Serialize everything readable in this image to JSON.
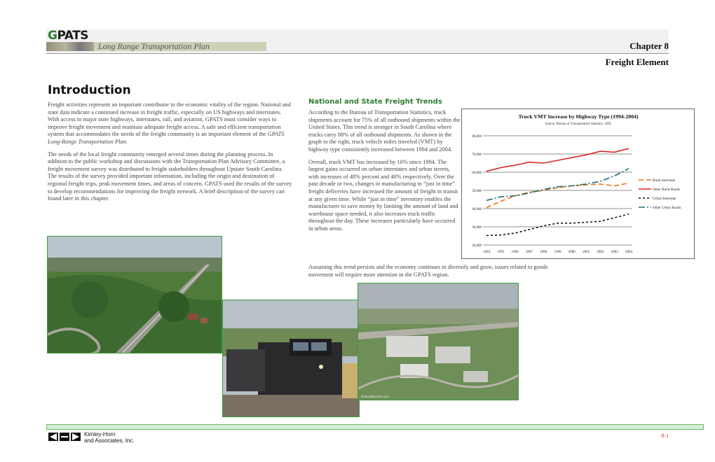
{
  "header": {
    "logo_g": "G",
    "logo_rest": "PATS",
    "plan_title": "Long Range Transportation Plan",
    "chapter": "Chapter 8",
    "element_title": "Freight Element"
  },
  "intro": {
    "heading": "Introduction",
    "p1a": "Freight activities represent an important contributor to the economic vitality of the region. National and state data indicate a continued increase in freight traffic, especially on US highways and interstates. With access to major state highways, interstates, rail, and aviation, GPATS must consider ways to improve freight movement and maintain adequate freight access. A safe and efficient transportation system that accommodates the needs of the freight community is an important element of the ",
    "p1_em": "GPATS Long-Range Transportation Plan.",
    "p2": "The needs of the local freight community emerged several times during the planning process. In addition to the public workshop and discussions with the Transportation Plan Advisory Committee, a freight movement survey was distributed to freight stakeholders throughout Upstate South Carolina. The results of the survey provided important information, including the origin and destination of regional freight trips, peak movement times, and areas of concern. GPATS used the results of the survey to develop recommendations for improving the freight network. A brief description of the survey can found later in this chapter."
  },
  "trends": {
    "heading": "National and State Freight Trends",
    "p1": "According to the Bureau of Transportation Statistics, truck shipments account for 75% of all outbound shipments within the United States. This trend is stronger in South Carolina where trucks carry 88% of all outbound shipments. As shown in the graph to the right, truck vehicle miles traveled (VMT) by highway type consistently increased between 1994 and 2004.",
    "p2": "Overall, truck VMT has increased by 10% since 1994. The largest gains occurred on urban interstates and urban streets, with increases of 48% percent and 40% respectively. Over the past decade or two, changes in manufacturing to “just in time” freight deliveries have increased the amount of freight in transit at any given time. While “just in time” inventory enables the manufacturer to save money by limiting the amount of land and warehouse space needed, it also increases truck traffic throughout the day. These increases particularly have occurred in urban areas.",
    "p3": "Assuming this trend persists and the economy continues to diversify and grow, issues related to goods movement will require more attention in the GPATS region."
  },
  "photos": {
    "photo3_credit": "RailroadCorner.com"
  },
  "chart_data": {
    "type": "line",
    "title": "Truck VMT Increase by Highway Type (1994-2004)",
    "subtitle": "Source: Bureau of Transportation Statistics, 2005",
    "x": [
      "1994",
      "1995",
      "1996",
      "1997",
      "1998",
      "1999",
      "2000",
      "2001",
      "2002",
      "2003",
      "2004"
    ],
    "y_ticks": [
      "80,000",
      "70,000",
      "60,000",
      "50,000",
      "40,000",
      "30,000",
      "20,000"
    ],
    "ylim": [
      20000,
      80000
    ],
    "legend_position": "right",
    "series": [
      {
        "name": "Rural Interstate",
        "color": "#e8731c",
        "dash": "7,4",
        "values": [
          40500,
          44000,
          47000,
          49000,
          50000,
          51500,
          52500,
          53000,
          53500,
          52500,
          54000
        ]
      },
      {
        "name": "Other Rural Roads",
        "color": "#d62728",
        "dash": "",
        "values": [
          60500,
          62500,
          63800,
          65500,
          65000,
          66500,
          68000,
          69500,
          71500,
          71000,
          73000
        ]
      },
      {
        "name": "Urban Interstate",
        "color": "#111111",
        "dash": "3,3",
        "values": [
          25200,
          25500,
          26500,
          28500,
          30500,
          32000,
          32000,
          32500,
          33000,
          35000,
          37000
        ]
      },
      {
        "name": "Other Urban Roads",
        "color": "#1f6f7a",
        "dash": "9,3,2,3",
        "values": [
          44500,
          46500,
          47000,
          48500,
          50500,
          52000,
          52500,
          53500,
          55000,
          58000,
          62000
        ]
      }
    ]
  },
  "footer": {
    "company_line1": "Kimley-Horn",
    "company_line2": "and Associates, Inc.",
    "page_number": "8-1"
  }
}
